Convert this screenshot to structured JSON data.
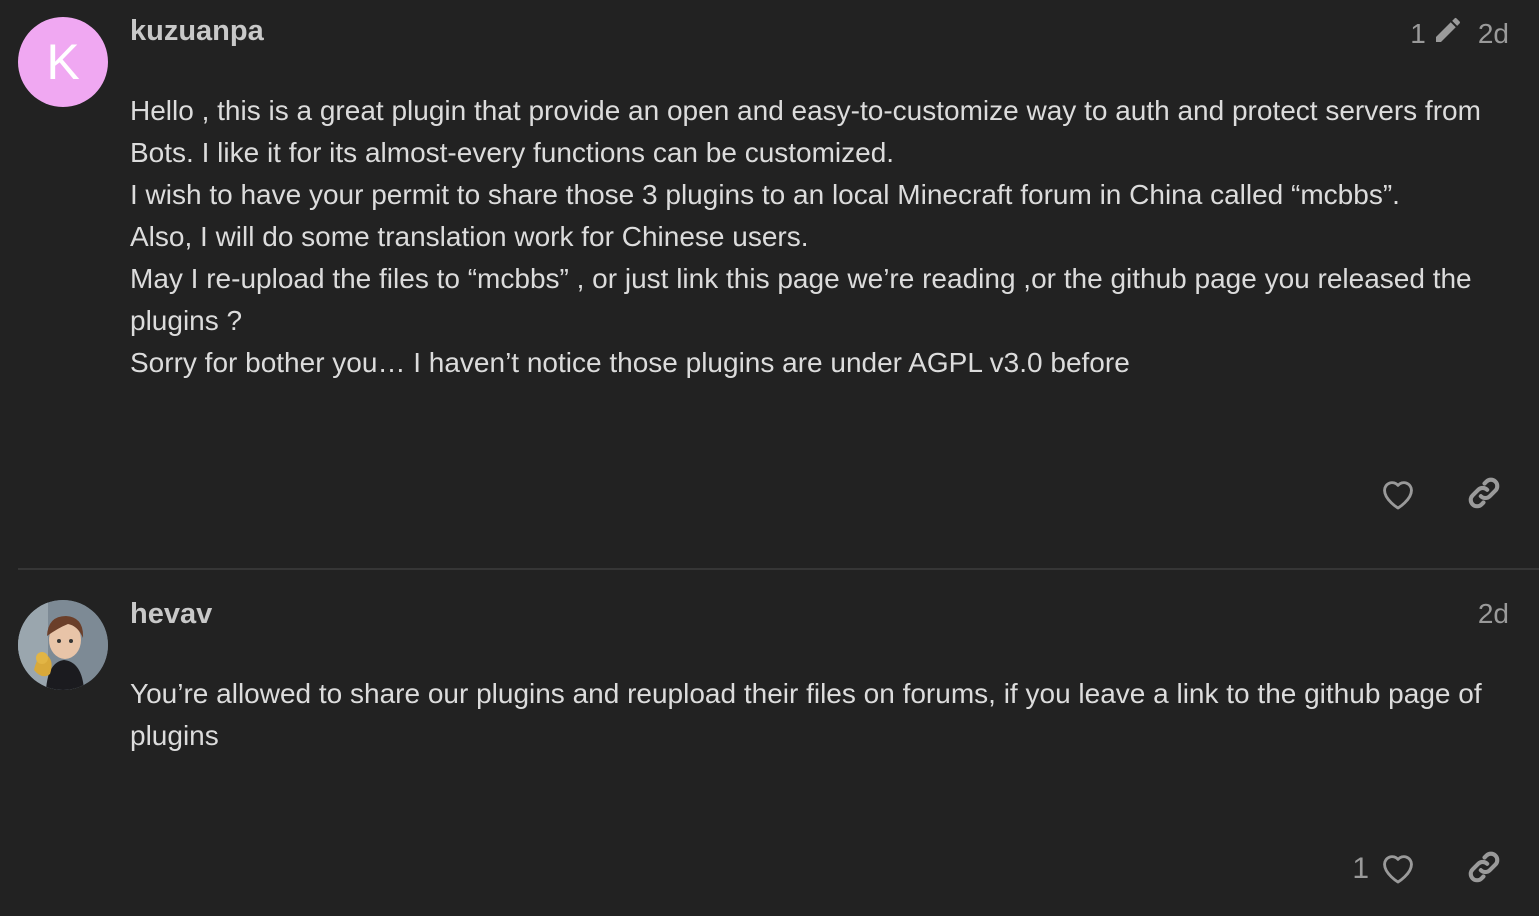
{
  "posts": [
    {
      "avatar_letter": "K",
      "username": "kuzuanpa",
      "edit_count": "1",
      "time": "2d",
      "paragraphs": [
        "Hello , this is a great plugin that provide an open and easy-to-customize way to auth and protect servers from Bots. I like it for its almost-every functions can be customized.",
        "I wish to have your permit to share those 3 plugins to an local Minecraft forum in China called “mcbbs”.",
        "Also, I will do some translation work for Chinese users.",
        "May I re-upload the files to “mcbbs” , or just link this page we’re reading ,or the github page you released the plugins ?",
        "Sorry for bother you… I haven’t notice those plugins are under AGPL v3.0 before"
      ],
      "like_count": ""
    },
    {
      "username": "hevav",
      "time": "2d",
      "paragraphs": [
        "You’re allowed to share our plugins and reupload their files on forums, if you leave a link to the github page of plugins"
      ],
      "like_count": "1"
    }
  ],
  "icons": {
    "edit": "pencil-icon",
    "like": "heart-icon",
    "share": "link-icon"
  },
  "colors": {
    "background": "#222222",
    "avatar_k": "#f0a8f2",
    "text": "#dcdcdc",
    "muted": "#9a9a9a"
  }
}
